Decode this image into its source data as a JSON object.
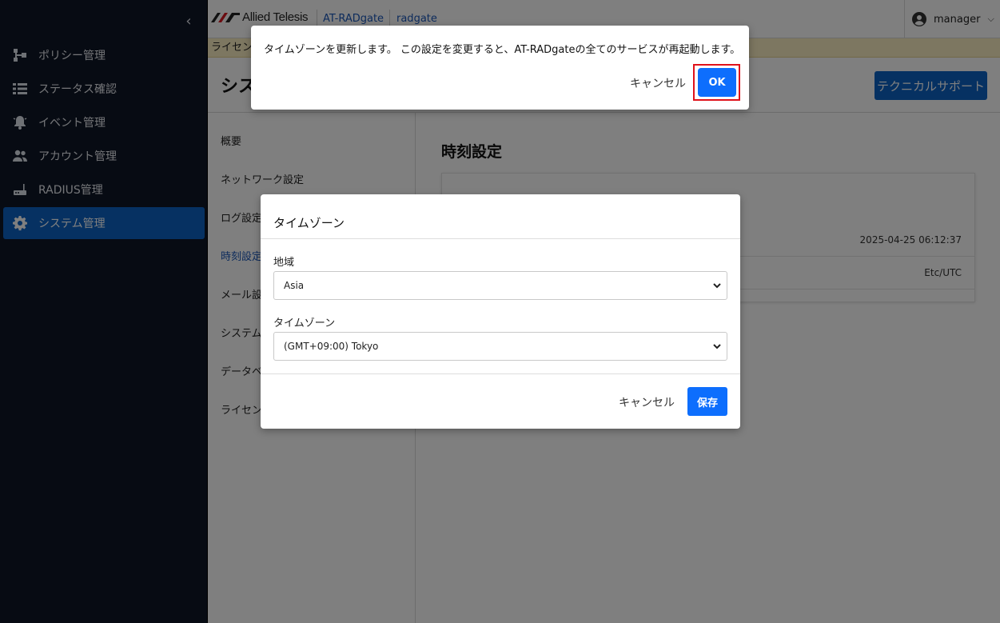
{
  "sidebar": {
    "collapse_icon": "chevron-left-icon",
    "items": [
      {
        "label": "ポリシー管理",
        "icon": "policy-icon"
      },
      {
        "label": "ステータス確認",
        "icon": "list-icon"
      },
      {
        "label": "イベント管理",
        "icon": "bell-icon"
      },
      {
        "label": "アカウント管理",
        "icon": "users-icon"
      },
      {
        "label": "RADIUS管理",
        "icon": "router-icon"
      },
      {
        "label": "システム管理",
        "icon": "gear-icon",
        "active": true
      }
    ]
  },
  "topbar": {
    "brand": "Allied Telesis",
    "product_link": "AT-RADgate",
    "host_link": "radgate",
    "user": "manager"
  },
  "license_banner": "ライセン",
  "page": {
    "title": "シス",
    "tech_support_button": "テクニカルサポート",
    "sub_nav": [
      "概要",
      "ネットワーク設定",
      "ログ設定",
      "時刻設定",
      "メール設",
      "システム",
      "データベ",
      "ライセン"
    ],
    "active_sub_nav": "時刻設定",
    "section_title": "時刻設定",
    "card_values": [
      "2025-04-25 06:12:37",
      "Etc/UTC"
    ]
  },
  "timezone_modal": {
    "title": "タイムゾーン",
    "region_label": "地域",
    "region_value": "Asia",
    "timezone_label": "タイムゾーン",
    "timezone_value": "(GMT+09:00) Tokyo",
    "cancel_label": "キャンセル",
    "save_label": "保存"
  },
  "confirm_dialog": {
    "message": "タイムゾーンを更新します。 この設定を変更すると、AT-RADgateの全てのサービスが再起動します。",
    "cancel_label": "キャンセル",
    "ok_label": "OK",
    "highlight_color": "#e0121b"
  },
  "colors": {
    "sidebar_bg": "#0f1626",
    "accent": "#0d62c4",
    "primary_button": "#0d6efd"
  }
}
